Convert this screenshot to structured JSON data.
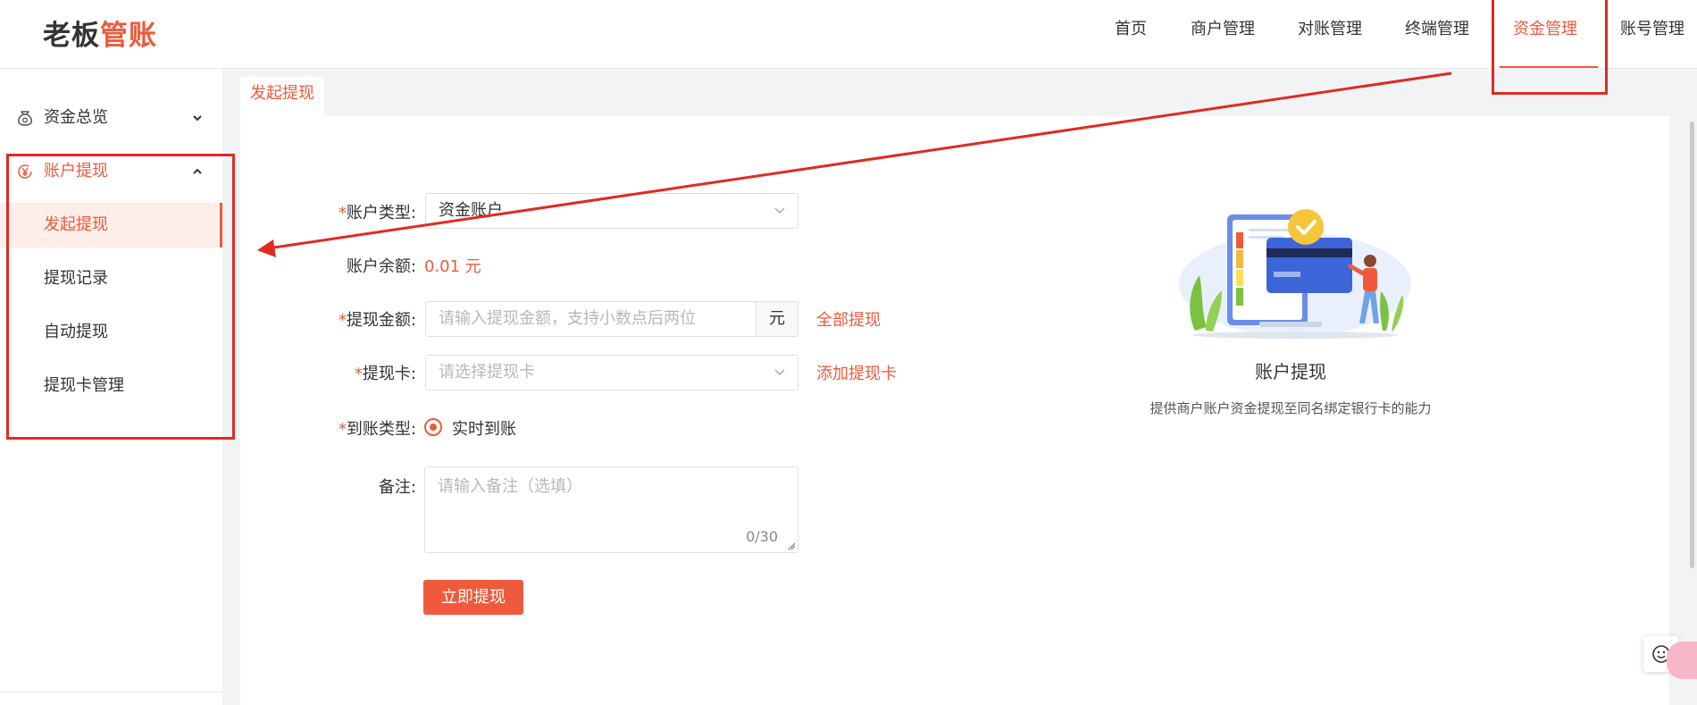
{
  "logo": {
    "part1": "老板",
    "part2": "管账"
  },
  "nav": {
    "items": [
      "首页",
      "商户管理",
      "对账管理",
      "终端管理",
      "资金管理",
      "账号管理"
    ],
    "active": "资金管理"
  },
  "sidebar": {
    "group1": {
      "label": "资金总览",
      "icon": "moneybag-icon"
    },
    "group2": {
      "label": "账户提现",
      "icon": "yen-circle-icon"
    },
    "sub_items": [
      "发起提现",
      "提现记录",
      "自动提现",
      "提现卡管理"
    ],
    "active_sub": "发起提现"
  },
  "tab": {
    "label": "发起提现"
  },
  "form": {
    "account_type": {
      "label": "账户类型:",
      "value": "资金账户"
    },
    "balance": {
      "label": "账户余额:",
      "value": "0.01 元"
    },
    "amount": {
      "label": "提现金额:",
      "placeholder": "请输入提现金额，支持小数点后两位",
      "suffix": "元",
      "link": "全部提现"
    },
    "card": {
      "label": "提现卡:",
      "placeholder": "请选择提现卡",
      "link": "添加提现卡"
    },
    "arrival_type": {
      "label": "到账类型:",
      "option": "实时到账"
    },
    "remark": {
      "label": "备注:",
      "placeholder": "请输入备注（选填）",
      "counter": "0/30"
    },
    "required_mark": "*",
    "submit_label": "立即提现"
  },
  "info": {
    "title": "账户提现",
    "description": "提供商户账户资金提现至同名绑定银行卡的能力"
  },
  "colors": {
    "accent": "#ee5a3c",
    "annotation": "#e02a22",
    "button": "#f05a3c"
  }
}
